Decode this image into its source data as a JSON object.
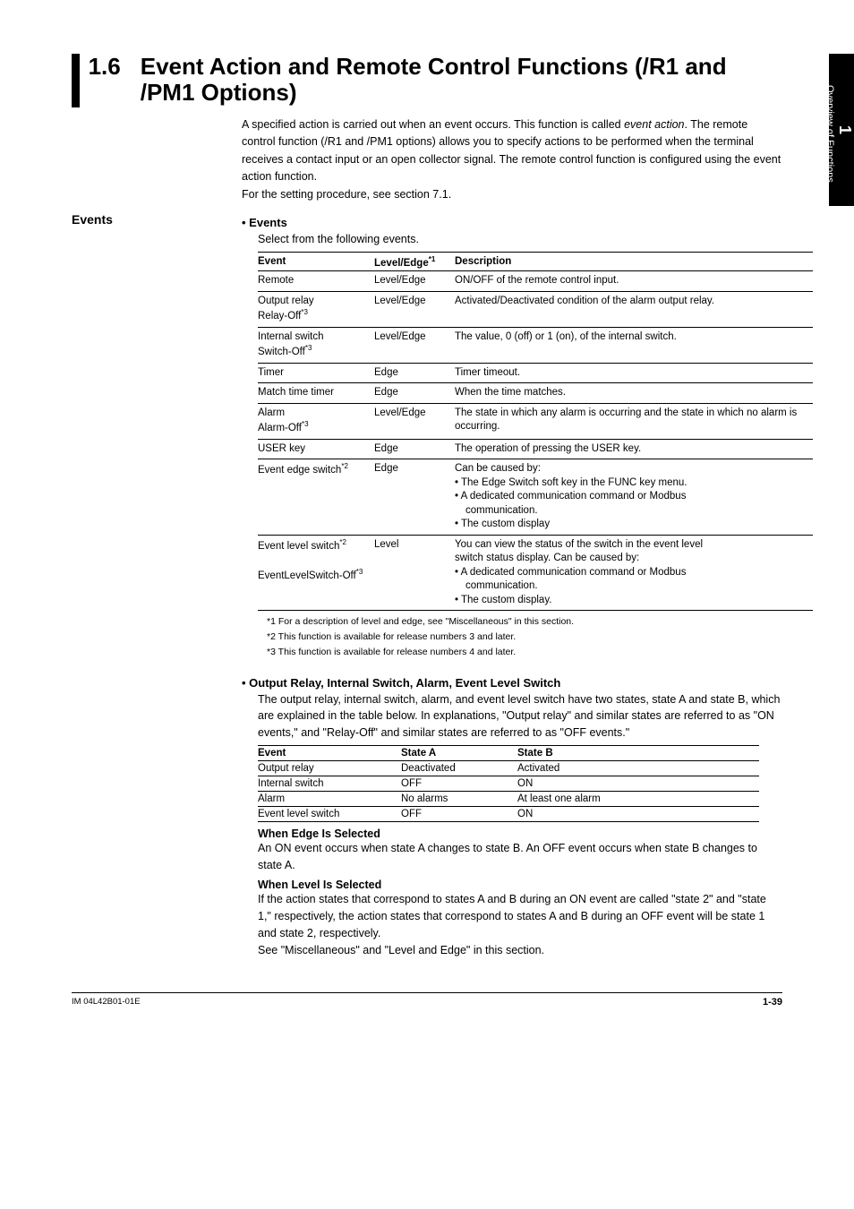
{
  "sidebar": {
    "num": "1",
    "label": "Overview of Functions"
  },
  "heading": {
    "num": "1.6",
    "title": "Event Action and Remote Control Functions (/R1 and /PM1 Options)"
  },
  "intro": {
    "l1": "A specified action is carried out when an event occurs. This function is called ",
    "l1em": "event action",
    "l1b": ". The remote control function (/R1 and /PM1 options) allows you to specify actions to be performed when the terminal receives a contact input or  an open collector signal. The remote control function is configured using the event action function.",
    "l2": "For the setting procedure, see section 7.1."
  },
  "events_label": "Events",
  "bullet_events": "•  Events",
  "select_line": "Select from the following events.",
  "table1": {
    "h1": "Event",
    "h2": "Level/Edge",
    "h2sup": "*1",
    "h3": "Description",
    "rows": [
      {
        "c1a": "Remote",
        "c1b": "",
        "c2": "Level/Edge",
        "c3": "ON/OFF of the remote control input."
      },
      {
        "c1a": "Output relay",
        "c1b": "Relay-Off",
        "c1bsup": "*3",
        "c2": "Level/Edge",
        "c3": "Activated/Deactivated condition of the alarm output relay."
      },
      {
        "c1a": "Internal switch",
        "c1b": "Switch-Off",
        "c1bsup": "*3",
        "c2": "Level/Edge",
        "c3": "The value, 0 (off) or 1 (on), of the internal switch."
      },
      {
        "c1a": "Timer",
        "c1b": "",
        "c2": "Edge",
        "c3": "Timer timeout."
      },
      {
        "c1a": "Match time timer",
        "c1b": "",
        "c2": "Edge",
        "c3": "When the time matches."
      },
      {
        "c1a": "Alarm",
        "c1b": "Alarm-Off",
        "c1bsup": "*3",
        "c2": "Level/Edge",
        "c3": "The state in which any alarm is occurring and the state in which no alarm is occurring."
      },
      {
        "c1a": "USER key",
        "c1b": "",
        "c2": "Edge",
        "c3": "The operation of pressing the USER key."
      }
    ],
    "row_edge": {
      "c1a": "Event edge switch",
      "c1asup": "*2",
      "c2": "Edge",
      "d0": "Can be caused by:",
      "d1": "• The Edge Switch soft key in the FUNC key menu.",
      "d2": "• A dedicated communication command or Modbus",
      "d2b": "communication.",
      "d3": "• The custom display"
    },
    "row_level": {
      "c1a": "Event level switch",
      "c1asup": "*2",
      "c1b": "EventLevelSwitch-Off",
      "c1bsup": "*3",
      "c2": "Level",
      "d0a": "You can view the status of the switch in the event level",
      "d0b": "switch status display. Can be caused by:",
      "d1": "• A dedicated communication command or Modbus",
      "d1b": "communication.",
      "d2": "• The custom display."
    }
  },
  "notes": {
    "n1": "*1  For a description of level and edge, see \"Miscellaneous\" in this section.",
    "n2": "*2  This function is available for release numbers 3 and later.",
    "n3": "*3  This function is available for release numbers 4 and later."
  },
  "bullet_output": "•  Output Relay, Internal Switch, Alarm, Event Level Switch",
  "output_body": "The output relay, internal switch, alarm, and event level switch have two states, state A and state B, which are explained in the table below. In explanations, \"Output relay\" and similar states are referred to as \"ON events,\" and \"Relay-Off\" and similar states are referred to as \"OFF events.\"",
  "table2": {
    "h1": "Event",
    "h2": "State A",
    "h3": "State B",
    "rows": [
      {
        "c1": "Output relay",
        "c2": "Deactivated",
        "c3": "Activated"
      },
      {
        "c1": "Internal switch",
        "c2": "OFF",
        "c3": "ON"
      },
      {
        "c1": "Alarm",
        "c2": "No alarms",
        "c3": "At least one alarm"
      },
      {
        "c1": "Event level switch",
        "c2": "OFF",
        "c3": "ON"
      }
    ]
  },
  "edge_h": "When Edge Is Selected",
  "edge_b": "An ON event occurs when state A changes to state B. An OFF event occurs when state B changes to state A.",
  "level_h": "When Level Is Selected",
  "level_b": "If the action states that correspond to states A and B during an ON event are called \"state 2\" and \"state 1,\" respectively, the action states that correspond to states A and B during an OFF event will be state 1 and state 2, respectively.",
  "level_b2": "See \"Miscellaneous\" and \"Level and Edge\" in this section.",
  "footer": {
    "code": "IM 04L42B01-01E",
    "page": "1-39"
  }
}
